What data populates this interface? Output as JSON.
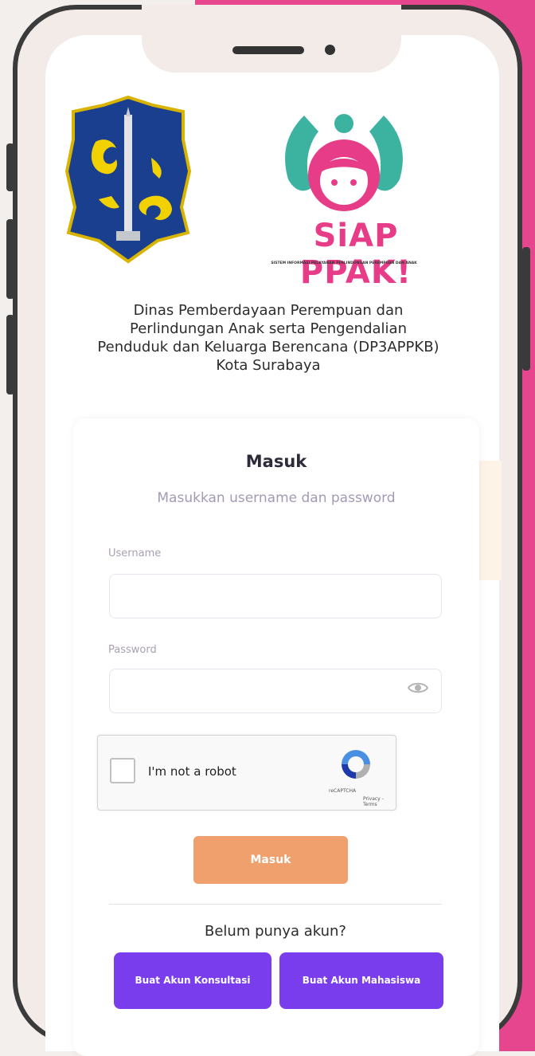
{
  "header": {
    "agency_line1": "Dinas Pemberdayaan Perempuan dan",
    "agency_line2": "Perlindungan Anak serta Pengendalian",
    "agency_line3": "Penduduk dan Keluarga Berencana (DP3APPKB)",
    "agency_line4": "Kota Surabaya",
    "siap_logo_text": "SiAP PPAK!",
    "siap_logo_subtitle": "SISTEM INFORMASI PELAYANAN PERLINDUNGAN PEREMPUAN DAN ANAK"
  },
  "login": {
    "title": "Masuk",
    "subtitle": "Masukkan username dan password",
    "username_label": "Username",
    "username_value": "",
    "password_label": "Password",
    "password_value": "",
    "submit_label": "Masuk"
  },
  "recaptcha": {
    "text": "I'm not a robot",
    "brand": "reCAPTCHA",
    "links": "Privacy - Terms"
  },
  "register": {
    "prompt": "Belum punya akun?",
    "consult_label": "Buat Akun Konsultasi",
    "student_label": "Buat Akun Mahasiswa"
  },
  "colors": {
    "pink_background": "#e5468e",
    "submit_orange": "#f0a06c",
    "register_purple": "#7a3ded",
    "siap_pink": "#e73d88",
    "siap_teal": "#3bb3a0"
  }
}
